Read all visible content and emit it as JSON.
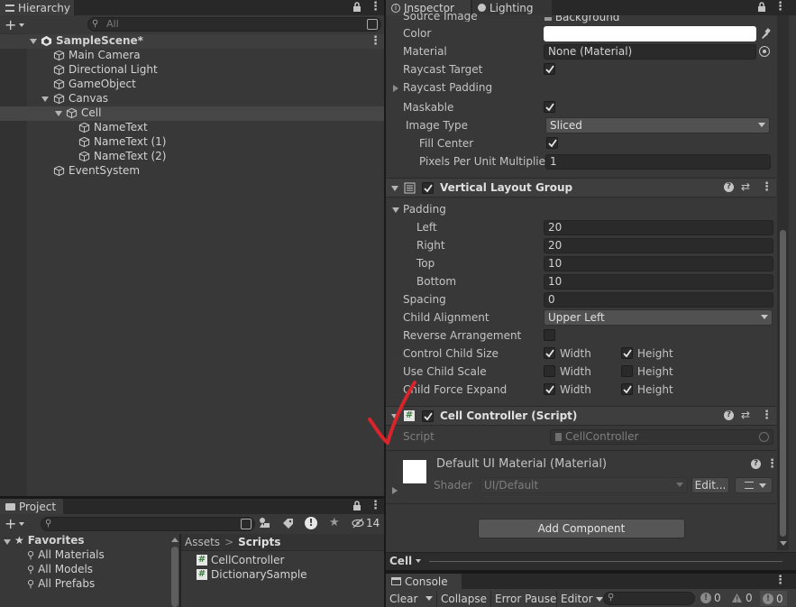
{
  "hierarchy": {
    "tab_label": "Hierarchy",
    "add_label": "+",
    "search_placeholder": "All",
    "scene_name": "SampleScene*",
    "items": [
      {
        "label": "Main Camera"
      },
      {
        "label": "Directional Light"
      },
      {
        "label": "GameObject"
      },
      {
        "label": "Canvas"
      },
      {
        "label": "Cell"
      },
      {
        "label": "NameText"
      },
      {
        "label": "NameText (1)"
      },
      {
        "label": "NameText (2)"
      },
      {
        "label": "EventSystem"
      }
    ]
  },
  "project": {
    "tab_label": "Project",
    "add_label": "+",
    "hidden_count": "14",
    "favorites_label": "Favorites",
    "favorites": [
      {
        "label": "All Materials"
      },
      {
        "label": "All Models"
      },
      {
        "label": "All Prefabs"
      }
    ],
    "breadcrumb": {
      "root": "Assets",
      "separator": ">",
      "current": "Scripts"
    },
    "files": [
      {
        "label": "CellController"
      },
      {
        "label": "DictionarySample"
      }
    ]
  },
  "inspector": {
    "tab_label": "Inspector",
    "lighting_tab_label": "Lighting",
    "image": {
      "source_image_label": "Source Image",
      "source_image_value": "Background",
      "color_label": "Color",
      "material_label": "Material",
      "material_value": "None (Material)",
      "raycast_target_label": "Raycast Target",
      "raycast_padding_label": "Raycast Padding",
      "maskable_label": "Maskable",
      "image_type_label": "Image Type",
      "image_type_value": "Sliced",
      "fill_center_label": "Fill Center",
      "ppu_label": "Pixels Per Unit Multiplier",
      "ppu_value": "1"
    },
    "vlg": {
      "title": "Vertical Layout Group",
      "padding_label": "Padding",
      "left_label": "Left",
      "left_value": "20",
      "right_label": "Right",
      "right_value": "20",
      "top_label": "Top",
      "top_value": "10",
      "bottom_label": "Bottom",
      "bottom_value": "10",
      "spacing_label": "Spacing",
      "spacing_value": "0",
      "child_alignment_label": "Child Alignment",
      "child_alignment_value": "Upper Left",
      "reverse_label": "Reverse Arrangement",
      "control_size_label": "Control Child Size",
      "use_scale_label": "Use Child Scale",
      "force_expand_label": "Child Force Expand",
      "width_label": "Width",
      "height_label": "Height"
    },
    "cell_controller": {
      "title": "Cell Controller (Script)",
      "script_label": "Script",
      "script_value": "CellController"
    },
    "material_preview": {
      "title": "Default UI Material (Material)",
      "shader_label": "Shader",
      "shader_value": "UI/Default",
      "edit_label": "Edit..."
    },
    "add_component_label": "Add Component",
    "footer_label": "Cell"
  },
  "console": {
    "tab_label": "Console",
    "clear_label": "Clear",
    "collapse_label": "Collapse",
    "error_pause_label": "Error Pause",
    "editor_label": "Editor",
    "log_count": "0",
    "warn_count": "0",
    "error_count": "0"
  },
  "colors": {
    "annotation_mark": "#d8242a",
    "selection_row": "#464646",
    "panel_bg": "#383838",
    "tab_active": "#3c3c3c"
  }
}
